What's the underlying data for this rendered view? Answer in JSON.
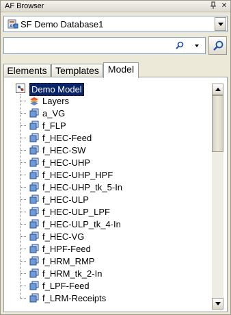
{
  "window": {
    "title": "AF Browser",
    "pin_icon": "pin-icon",
    "close_icon": "close-icon"
  },
  "database": {
    "selected": "SF Demo Database1",
    "icon": "af-database-icon"
  },
  "search": {
    "value": "",
    "placeholder": "",
    "search_icon": "magnifier-icon",
    "go_icon": "magnifier-icon"
  },
  "tabs": [
    {
      "label": "Elements",
      "active": false
    },
    {
      "label": "Templates",
      "active": false
    },
    {
      "label": "Model",
      "active": true
    }
  ],
  "tree": {
    "root": {
      "label": "Demo Model",
      "icon": "model-icon",
      "selected": true
    },
    "children": [
      {
        "label": "Layers",
        "icon": "layers-icon"
      },
      {
        "label": "a_VG",
        "icon": "element-icon"
      },
      {
        "label": "f_FLP",
        "icon": "element-icon"
      },
      {
        "label": "f_HEC-Feed",
        "icon": "element-icon"
      },
      {
        "label": "f_HEC-SW",
        "icon": "element-icon"
      },
      {
        "label": "f_HEC-UHP",
        "icon": "element-icon"
      },
      {
        "label": "f_HEC-UHP_HPF",
        "icon": "element-icon"
      },
      {
        "label": "f_HEC-UHP_tk_5-In",
        "icon": "element-icon"
      },
      {
        "label": "f_HEC-ULP",
        "icon": "element-icon"
      },
      {
        "label": "f_HEC-ULP_LPF",
        "icon": "element-icon"
      },
      {
        "label": "f_HEC-ULP_tk_4-In",
        "icon": "element-icon"
      },
      {
        "label": "f_HEC-VG",
        "icon": "element-icon"
      },
      {
        "label": "f_HPF-Feed",
        "icon": "element-icon"
      },
      {
        "label": "f_HRM_RMP",
        "icon": "element-icon"
      },
      {
        "label": "f_HRM_tk_2-In",
        "icon": "element-icon"
      },
      {
        "label": "f_LPF-Feed",
        "icon": "element-icon"
      },
      {
        "label": "f_LRM-Receipts",
        "icon": "element-icon"
      }
    ]
  }
}
